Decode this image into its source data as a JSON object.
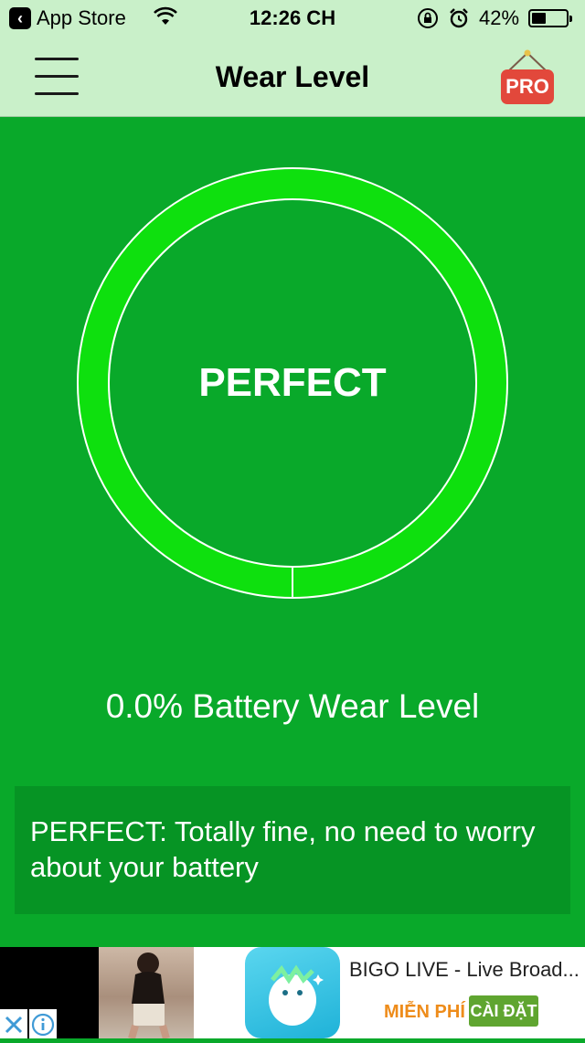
{
  "status_bar": {
    "back_label": "App Store",
    "time": "12:26 CH",
    "battery_percent": "42%",
    "battery_level": 0.42
  },
  "nav": {
    "title": "Wear Level",
    "pro_label": "PRO"
  },
  "gauge": {
    "status": "PERFECT",
    "wear_level_fraction": 0.0,
    "ring_color": "#0ee00e",
    "background_color": "#09a92a"
  },
  "wear_text": "0.0% Battery Wear Level",
  "message": "PERFECT: Totally fine, no need to worry about your battery",
  "ad": {
    "app_name": "BIGO LIVE - Live Broad...",
    "price_label": "MIỄN PHÍ",
    "install_label": "CÀI ĐẶT"
  }
}
